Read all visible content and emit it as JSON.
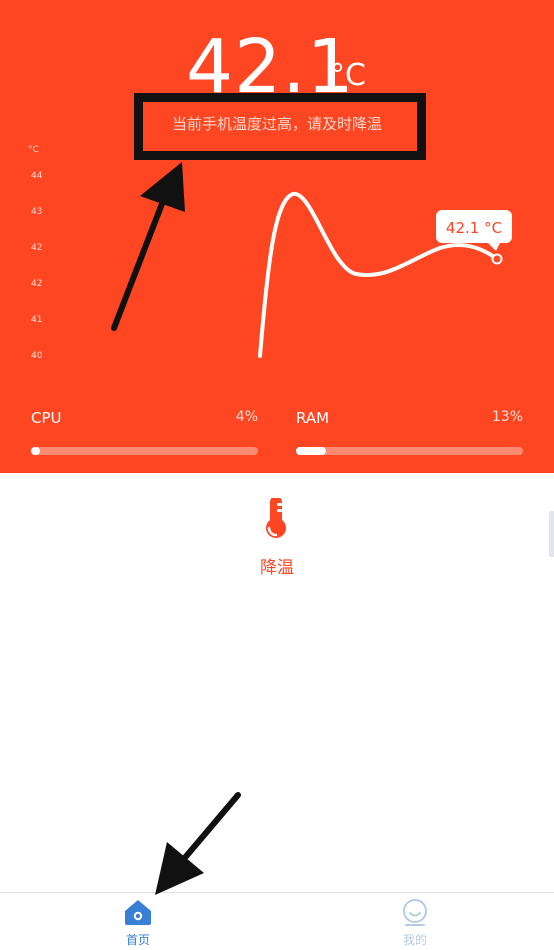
{
  "temperature": {
    "value": "42.1",
    "unit": "°C",
    "warning": "当前手机温度过高，请及时降温"
  },
  "chart": {
    "unit_label": "°C",
    "y_ticks": [
      "44",
      "43",
      "42",
      "42",
      "41",
      "40"
    ],
    "callout": "42.1 °C"
  },
  "chart_data": {
    "type": "line",
    "title": "",
    "ylabel": "°C",
    "y_tick_labels": [
      "44",
      "43",
      "42",
      "42",
      "41",
      "40"
    ],
    "series": [
      {
        "values": [
          40.0,
          43.6,
          41.9,
          42.0,
          42.1
        ]
      }
    ]
  },
  "resources": {
    "cpu": {
      "label": "CPU",
      "percent_text": "4%",
      "fraction": 0.04
    },
    "ram": {
      "label": "RAM",
      "percent_text": "13%",
      "fraction": 0.13
    }
  },
  "action": {
    "icon": "thermometer-icon",
    "label": "降温"
  },
  "nav": {
    "home": {
      "label": "首页",
      "icon": "home-icon",
      "color": "#3a7fd6"
    },
    "mine": {
      "label": "我的",
      "icon": "user-icon",
      "color": "#b8cbe6"
    }
  },
  "colors": {
    "accent": "#fe4622"
  }
}
